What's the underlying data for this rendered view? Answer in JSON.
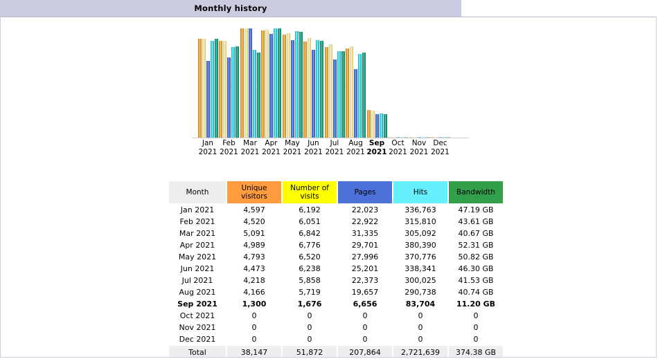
{
  "page": {
    "title": "Monthly history",
    "theme": {
      "titlebar_bg": "#cccce0",
      "frame_border": "#cccce0",
      "header_month_bg": "#eeeeee",
      "header_visitors_bg": "#ff9c3f",
      "header_visits_bg": "#ffff00",
      "header_pages_bg": "#4a72d8",
      "header_hits_bg": "#66f0ff",
      "header_bandwidth_bg": "#32a04a",
      "total_row_bg": "#eeeeee"
    }
  },
  "table": {
    "headers": {
      "month": "Month",
      "unique_visitors": "Unique visitors",
      "number_of_visits": "Number of visits",
      "pages": "Pages",
      "hits": "Hits",
      "bandwidth": "Bandwidth"
    },
    "rows": [
      {
        "month": "Jan 2021",
        "unique_visitors": "4,597",
        "visits": "6,192",
        "pages": "22,023",
        "hits": "336,763",
        "bandwidth": "47.19 GB",
        "current": false
      },
      {
        "month": "Feb 2021",
        "unique_visitors": "4,520",
        "visits": "6,051",
        "pages": "22,922",
        "hits": "315,810",
        "bandwidth": "43.61 GB",
        "current": false
      },
      {
        "month": "Mar 2021",
        "unique_visitors": "5,091",
        "visits": "6,842",
        "pages": "31,335",
        "hits": "305,092",
        "bandwidth": "40.67 GB",
        "current": false
      },
      {
        "month": "Apr 2021",
        "unique_visitors": "4,989",
        "visits": "6,776",
        "pages": "29,701",
        "hits": "380,390",
        "bandwidth": "52.31 GB",
        "current": false
      },
      {
        "month": "May 2021",
        "unique_visitors": "4,793",
        "visits": "6,520",
        "pages": "27,996",
        "hits": "370,776",
        "bandwidth": "50.82 GB",
        "current": false
      },
      {
        "month": "Jun 2021",
        "unique_visitors": "4,473",
        "visits": "6,238",
        "pages": "25,201",
        "hits": "338,341",
        "bandwidth": "46.30 GB",
        "current": false
      },
      {
        "month": "Jul 2021",
        "unique_visitors": "4,218",
        "visits": "5,858",
        "pages": "22,373",
        "hits": "300,025",
        "bandwidth": "41.53 GB",
        "current": false
      },
      {
        "month": "Aug 2021",
        "unique_visitors": "4,166",
        "visits": "5,719",
        "pages": "19,657",
        "hits": "290,738",
        "bandwidth": "40.74 GB",
        "current": false
      },
      {
        "month": "Sep 2021",
        "unique_visitors": "1,300",
        "visits": "1,676",
        "pages": "6,656",
        "hits": "83,704",
        "bandwidth": "11.20 GB",
        "current": true
      },
      {
        "month": "Oct 2021",
        "unique_visitors": "0",
        "visits": "0",
        "pages": "0",
        "hits": "0",
        "bandwidth": "0",
        "current": false
      },
      {
        "month": "Nov 2021",
        "unique_visitors": "0",
        "visits": "0",
        "pages": "0",
        "hits": "0",
        "bandwidth": "0",
        "current": false
      },
      {
        "month": "Dec 2021",
        "unique_visitors": "0",
        "visits": "0",
        "pages": "0",
        "hits": "0",
        "bandwidth": "0",
        "current": false
      }
    ],
    "total": {
      "label": "Total",
      "unique_visitors": "38,147",
      "visits": "51,872",
      "pages": "207,864",
      "hits": "2,721,639",
      "bandwidth": "374.38 GB"
    }
  },
  "chart_data": {
    "type": "bar",
    "title": "Monthly history",
    "xlabel": "",
    "ylabel": "",
    "grid": false,
    "legend_position": "none",
    "categories": [
      "Jan 2021",
      "Feb 2021",
      "Mar 2021",
      "Apr 2021",
      "May 2021",
      "Jun 2021",
      "Jul 2021",
      "Aug 2021",
      "Sep 2021",
      "Oct 2021",
      "Nov 2021",
      "Dec 2021"
    ],
    "category_lines": [
      [
        "Jan",
        "2021"
      ],
      [
        "Feb",
        "2021"
      ],
      [
        "Mar",
        "2021"
      ],
      [
        "Apr",
        "2021"
      ],
      [
        "May",
        "2021"
      ],
      [
        "Jun",
        "2021"
      ],
      [
        "Jul",
        "2021"
      ],
      [
        "Aug",
        "2021"
      ],
      [
        "Sep",
        "2021"
      ],
      [
        "Oct",
        "2021"
      ],
      [
        "Nov",
        "2021"
      ],
      [
        "Dec",
        "2021"
      ]
    ],
    "highlighted_category": "Sep 2021",
    "series": [
      {
        "name": "Unique visitors",
        "color": "#ff9c3f",
        "max": 5091,
        "values": [
          4597,
          4520,
          5091,
          4989,
          4793,
          4473,
          4218,
          4166,
          1300,
          0,
          0,
          0
        ]
      },
      {
        "name": "Number of visits",
        "color": "#f0e68c",
        "max": 6842,
        "values": [
          6192,
          6051,
          6842,
          6776,
          6520,
          6238,
          5858,
          5719,
          1676,
          0,
          0,
          0
        ]
      },
      {
        "name": "Pages",
        "color": "#4a72d8",
        "max": 31335,
        "values": [
          22023,
          22922,
          31335,
          29701,
          27996,
          25201,
          22373,
          19657,
          6656,
          0,
          0,
          0
        ]
      },
      {
        "name": "Hits",
        "color": "#66f0ff",
        "max": 380390,
        "values": [
          336763,
          315810,
          305092,
          380390,
          370776,
          338341,
          300025,
          290738,
          83704,
          0,
          0,
          0
        ]
      },
      {
        "name": "Bandwidth",
        "color": "#2aa587",
        "max": 52.31,
        "values": [
          47.19,
          43.61,
          40.67,
          52.31,
          50.82,
          46.3,
          41.53,
          40.74,
          11.2,
          0,
          0,
          0
        ]
      }
    ]
  }
}
